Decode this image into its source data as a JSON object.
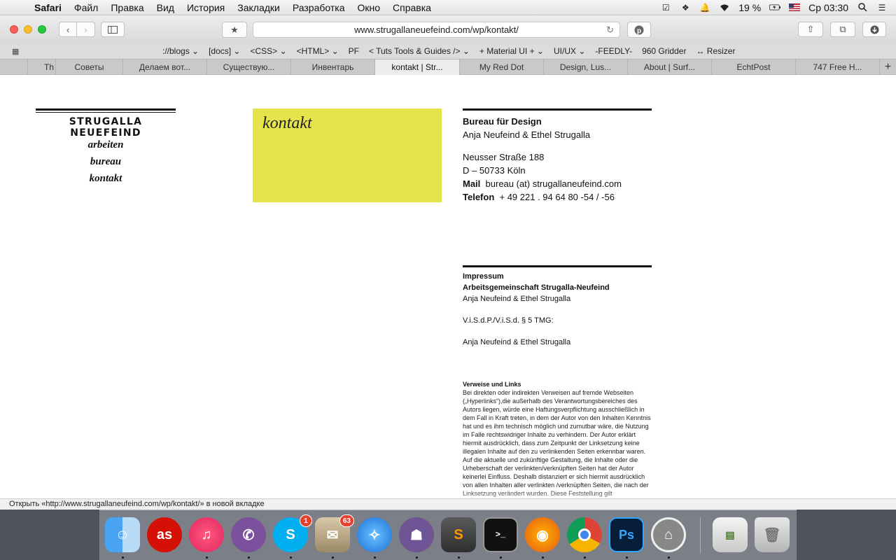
{
  "menubar": {
    "app": "Safari",
    "items": [
      "Файл",
      "Правка",
      "Вид",
      "История",
      "Закладки",
      "Разработка",
      "Окно",
      "Справка"
    ],
    "battery": "19 %",
    "clock": "Ср 03:30"
  },
  "toolbar": {
    "url": "www.strugallaneuefeind.com/wp/kontakt/"
  },
  "favorites": [
    "://blogs ⌄",
    "[docs] ⌄",
    "<CSS> ⌄",
    "<HTML> ⌄",
    "PF",
    "< Tuts Tools & Guides /> ⌄",
    "+ Material UI + ⌄",
    "UI/UX ⌄",
    "-FEEDLY-",
    "960 Gridder",
    "↔ Resizer"
  ],
  "tabs": [
    {
      "label": "Th",
      "w": 0
    },
    {
      "label": "Советы"
    },
    {
      "label": "Делаем вот..."
    },
    {
      "label": "Существую..."
    },
    {
      "label": "Инвентарь"
    },
    {
      "label": "kontakt | Str...",
      "active": true
    },
    {
      "label": "My Red Dot"
    },
    {
      "label": "Design, Lus..."
    },
    {
      "label": "About | Surf..."
    },
    {
      "label": "EchtPost"
    },
    {
      "label": "747 Free H..."
    }
  ],
  "site": {
    "logo": "STRUGALLA NEUEFEIND",
    "nav": [
      "arbeiten",
      "bureau",
      "kontakt"
    ],
    "section_title": "kontakt",
    "contact": {
      "heading": "Bureau für Design",
      "names": "Anja Neufeind & Ethel Strugalla",
      "street": "Neusser Straße 188",
      "city": "D – 50733 Köln",
      "mail_label": "Mail",
      "mail_value": "bureau (at) strugallaneufeind.com",
      "phone_label": "Telefon",
      "phone_value": "+ 49 221 . 94 64 80 -54 / -56"
    },
    "impressum": {
      "heading": "Impressum",
      "org": "Arbeitsgemeinschaft Strugalla-Neufeind",
      "names": "Anja Neufeind & Ethel Strugalla",
      "visdp": "V.i.S.d.P./V.i.S.d. § 5 TMG:",
      "names2": "Anja Neufeind & Ethel Strugalla"
    },
    "links_heading": "Verweise und Links",
    "links_text": "Bei direkten oder indirekten Verweisen auf fremde Webseiten („Hyperlinks“),die außerhalb des Verantwortungsbereiches des Autors liegen, würde eine Haftungsverpflichtung ausschließlich in dem Fall in Kraft treten, in dem der Autor von den Inhalten Kenntnis hat und es ihm technisch möglich und zumutbar wäre, die Nutzung im Falle rechtswidriger Inhalte zu verhindern. Der Autor erklärt hiermit ausdrücklich, dass zum Zeitpunkt der Linksetzung keine illegalen Inhalte auf den zu verlinkenden Seiten erkennbar waren. Auf die aktuelle und zukünftige Gestaltung, die Inhalte oder die Urheberschaft der verlinkten/verknüpften Seiten hat der Autor keinerlei Einfluss. Deshalb distanziert er sich hiermit ausdrücklich von allen Inhalten aller verlinkten /verknüpften Seiten, die nach der Linksetzung verändert wurden. Diese Feststellung gilt"
  },
  "status": "Открыть «http://www.strugallaneufeind.com/wp/kontakt/» в новой вкладке",
  "dock": {
    "skype_badge": "1",
    "mail_badge": "63",
    "icons": [
      "finder-icon",
      "lastfm-icon",
      "itunes-icon",
      "viber-icon",
      "skype-icon",
      "mail-icon",
      "safari-icon",
      "github-icon",
      "sublime-icon",
      "terminal-icon",
      "firefox-icon",
      "chrome-icon",
      "photoshop-icon",
      "mamp-icon",
      "downloads-stack-icon",
      "trash-icon"
    ]
  }
}
